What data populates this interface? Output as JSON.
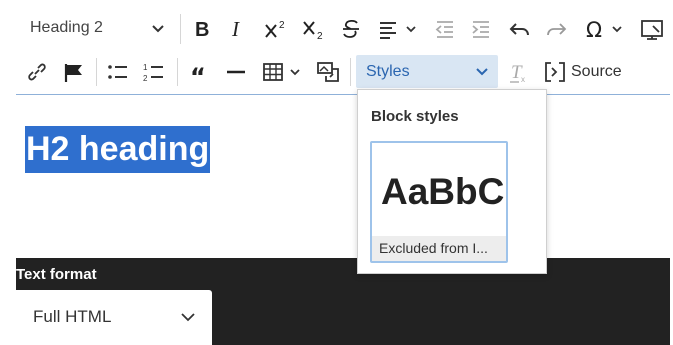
{
  "toolbar": {
    "heading_select": "Heading 2",
    "styles_select": "Styles",
    "source_label": "Source"
  },
  "editor": {
    "heading_text": "H2 heading"
  },
  "styles_panel": {
    "title": "Block styles",
    "items": [
      {
        "preview": "AaBbC",
        "caption": "Excluded from I..."
      }
    ]
  },
  "footer": {
    "text_format_label": "Text format",
    "format_value": "Full HTML"
  },
  "colors": {
    "selection": "#2f6fce",
    "styles_bg": "#d9e6f3",
    "styles_text": "#2b66b0",
    "dark_bg": "#222222"
  }
}
